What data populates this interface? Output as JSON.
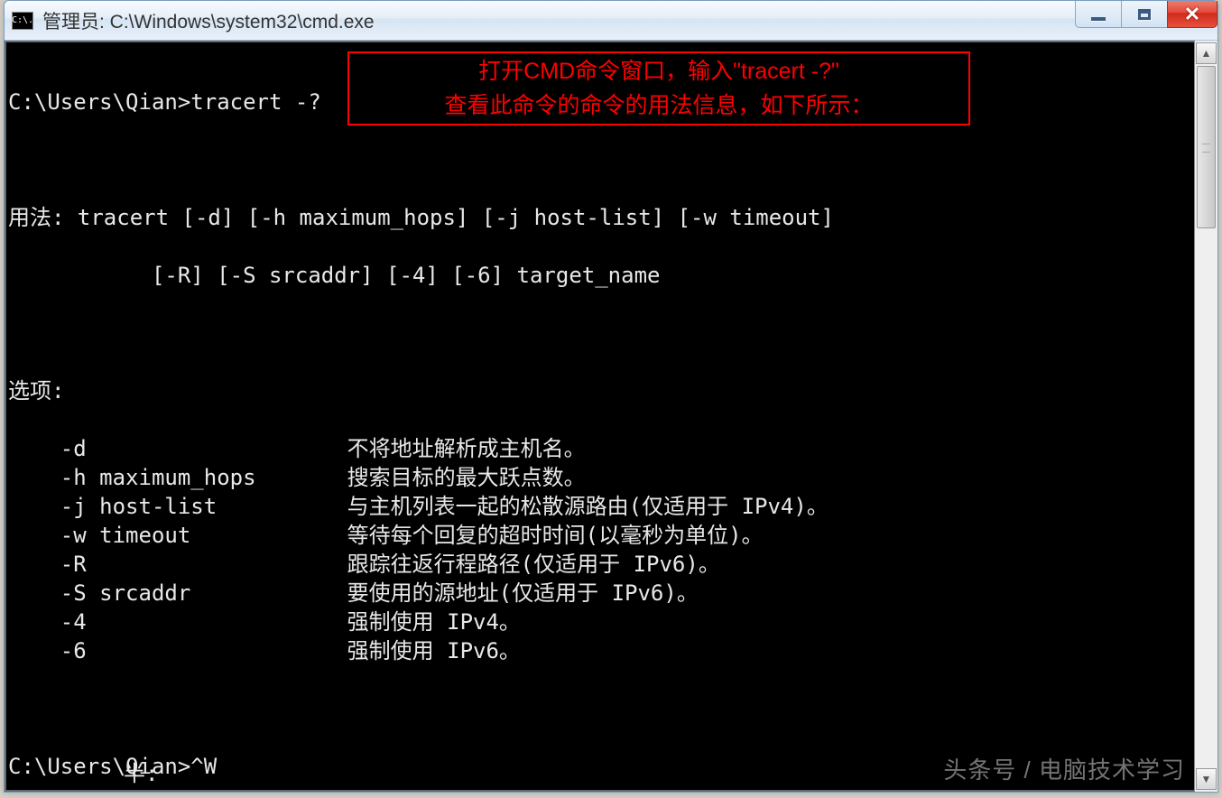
{
  "window": {
    "icon_label": "C:\\.",
    "title": "管理员: C:\\Windows\\system32\\cmd.exe"
  },
  "annotation": {
    "line1": "打开CMD命令窗口，输入\"tracert -?\"",
    "line2": "查看此命令的命令的用法信息，如下所示："
  },
  "terminal": {
    "prompt1": "C:\\Users\\Qian>tracert -?",
    "usage_label": "用法:",
    "usage_line1": " tracert [-d] [-h maximum_hops] [-j host-list] [-w timeout]",
    "usage_line2": "           [-R] [-S srcaddr] [-4] [-6] target_name",
    "options_label": "选项:",
    "options": [
      {
        "flag": "-d",
        "desc": "不将地址解析成主机名。"
      },
      {
        "flag": "-h maximum_hops",
        "desc": "搜索目标的最大跃点数。"
      },
      {
        "flag": "-j host-list",
        "desc": "与主机列表一起的松散源路由(仅适用于 IPv4)。"
      },
      {
        "flag": "-w timeout",
        "desc": "等待每个回复的超时时间(以毫秒为单位)。"
      },
      {
        "flag": "-R",
        "desc": "跟踪往返行程路径(仅适用于 IPv6)。"
      },
      {
        "flag": "-S srcaddr",
        "desc": "要使用的源地址(仅适用于 IPv6)。"
      },
      {
        "flag": "-4",
        "desc": "强制使用 IPv4。"
      },
      {
        "flag": "-6",
        "desc": "强制使用 IPv6。"
      }
    ],
    "prompt2": "C:\\Users\\Qian>^W",
    "partial_bottom": "         半:"
  },
  "watermark": "头条号 / 电脑技术学习"
}
